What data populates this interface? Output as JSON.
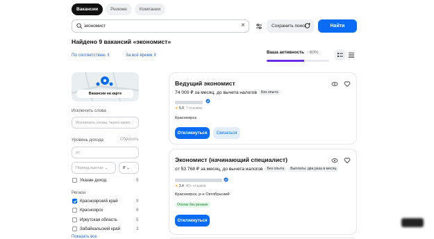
{
  "tabs": [
    {
      "label": "Вакансии",
      "active": true
    },
    {
      "label": "Резюме",
      "active": false
    },
    {
      "label": "Компании",
      "active": false
    }
  ],
  "search": {
    "value": "экономист",
    "icon": "search-icon",
    "clear_icon": "close-icon"
  },
  "toolbar": {
    "save_label": "Сохранить поиск",
    "find_label": "Найти"
  },
  "results_title": "Найдено 9 вакансий «экономист»",
  "sort": {
    "relevance_label": "По соответствию",
    "period_label": "За всё время"
  },
  "activity": {
    "label": "Ваша активность",
    "percent_label": "60%",
    "value": 0.6
  },
  "map": {
    "button_label": "Вакансии на карте"
  },
  "filters": {
    "exclude_label": "Исключить слова",
    "exclude_placeholder": "Исключить слова, через запят...",
    "income_label": "Уровень дохода",
    "income_reset": "Сбросить",
    "income_from_placeholder": "от",
    "period_placeholder": "Период выплат",
    "currency_symbol": "₽",
    "income_specified": {
      "label": "Указан доход",
      "count": "5"
    },
    "region_label": "Регион",
    "regions": [
      {
        "label": "Красноярский край",
        "count": "9",
        "checked": true
      },
      {
        "label": "Красноярск",
        "count": "8",
        "checked": false
      },
      {
        "label": "Иркутская область",
        "count": "5",
        "checked": false
      },
      {
        "label": "Забайкальский край",
        "count": "3",
        "checked": false
      }
    ],
    "show_all": "Показать все"
  },
  "vacancies": [
    {
      "title": "Ведущий экономист",
      "salary": "74 000 ₽ за месяц, до вычета налогов",
      "badges": [
        "Без опыта"
      ],
      "rating": "5.0",
      "reviews": "7 отзывов",
      "city": "Красноярск",
      "respond_label": "Откликнуться",
      "contact_label": "Связаться"
    },
    {
      "title": "Экономист (начинающий специалист)",
      "salary": "от 53 768 ₽ за месяц, до вычета налогов",
      "badges": [
        "Без опыта",
        "Выплаты: два раза в месяц"
      ],
      "rating": "3.4",
      "reviews": "40+ отзывов",
      "city": "Красноярск, р-н Октябрьский",
      "note": "Отклик без резюме",
      "respond_label": "Откликнуться"
    }
  ],
  "colors": {
    "accent": "#0a6cf5",
    "activity": "#6a2de3",
    "text": "#111111"
  }
}
